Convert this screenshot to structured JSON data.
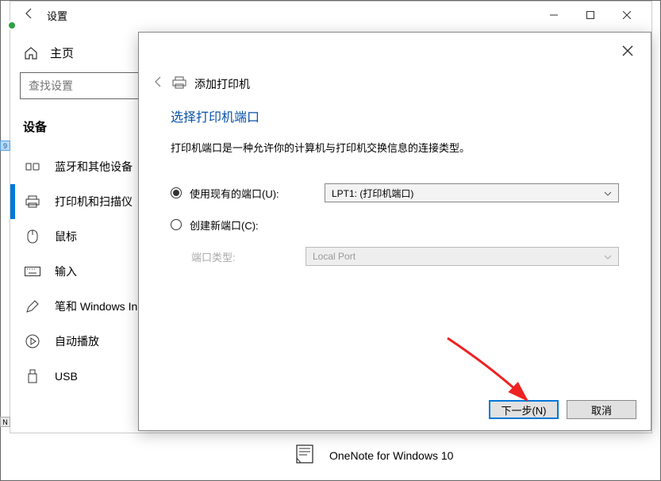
{
  "settings": {
    "title": "设置",
    "home": "主页",
    "search_placeholder": "查找设置",
    "section": "设备",
    "nav": [
      {
        "label": "蓝牙和其他设备"
      },
      {
        "label": "打印机和扫描仪"
      },
      {
        "label": "鼠标"
      },
      {
        "label": "输入"
      },
      {
        "label": "笔和 Windows Ink"
      },
      {
        "label": "自动播放"
      },
      {
        "label": "USB"
      }
    ]
  },
  "dialog": {
    "breadcrumb": "添加打印机",
    "title": "选择打印机端口",
    "description": "打印机端口是一种允许你的计算机与打印机交换信息的连接类型。",
    "opt_existing": "使用现有的端口(U):",
    "opt_existing_value": "LPT1: (打印机端口)",
    "opt_create": "创建新端口(C):",
    "port_type_label": "端口类型:",
    "port_type_value": "Local Port",
    "next": "下一步(N)",
    "cancel": "取消"
  },
  "bottom_item": "OneNote for Windows 10"
}
